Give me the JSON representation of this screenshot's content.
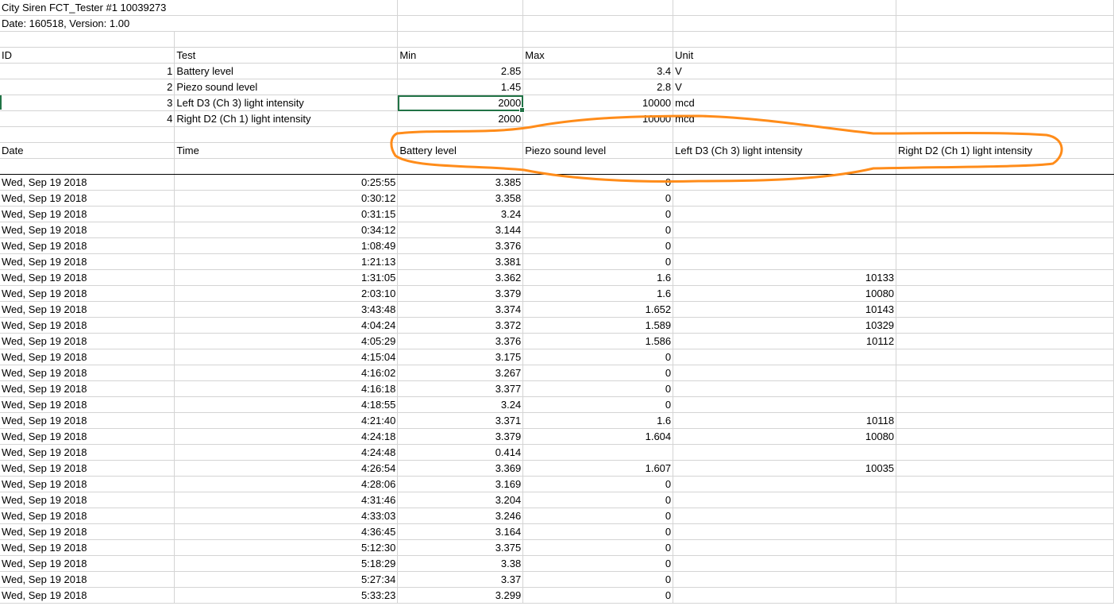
{
  "header": {
    "title": "City Siren FCT_Tester #1 10039273",
    "subtitle": "Date: 160518, Version: 1.00"
  },
  "limits": {
    "columns": [
      "ID",
      "Test",
      "Min",
      "Max",
      "Unit"
    ],
    "rows": [
      {
        "id": "1",
        "test": "Battery level",
        "min": "2.85",
        "max": "3.4",
        "unit": "V"
      },
      {
        "id": "2",
        "test": "Piezo sound level",
        "min": "1.45",
        "max": "2.8",
        "unit": "V"
      },
      {
        "id": "3",
        "test": "Left D3  (Ch 3) light intensity",
        "min": "2000",
        "max": "10000",
        "unit": "mcd"
      },
      {
        "id": "4",
        "test": "Right D2  (Ch 1) light intensity",
        "min": "2000",
        "max": "10000",
        "unit": "mcd"
      }
    ]
  },
  "log": {
    "columns": [
      "Date",
      "Time",
      "Battery level",
      "Piezo sound level",
      "Left D3  (Ch 3) light intensity",
      "Right D2  (Ch 1) light intensity"
    ],
    "rows": [
      {
        "date": "Wed, Sep 19  2018",
        "time": "0:25:55",
        "battery": "3.385",
        "piezo": "0",
        "left": "",
        "right": ""
      },
      {
        "date": "Wed, Sep 19  2018",
        "time": "0:30:12",
        "battery": "3.358",
        "piezo": "0",
        "left": "",
        "right": ""
      },
      {
        "date": "Wed, Sep 19  2018",
        "time": "0:31:15",
        "battery": "3.24",
        "piezo": "0",
        "left": "",
        "right": ""
      },
      {
        "date": "Wed, Sep 19  2018",
        "time": "0:34:12",
        "battery": "3.144",
        "piezo": "0",
        "left": "",
        "right": ""
      },
      {
        "date": "Wed, Sep 19  2018",
        "time": "1:08:49",
        "battery": "3.376",
        "piezo": "0",
        "left": "",
        "right": ""
      },
      {
        "date": "Wed, Sep 19  2018",
        "time": "1:21:13",
        "battery": "3.381",
        "piezo": "0",
        "left": "",
        "right": ""
      },
      {
        "date": "Wed, Sep 19  2018",
        "time": "1:31:05",
        "battery": "3.362",
        "piezo": "1.6",
        "left": "10133",
        "right": ""
      },
      {
        "date": "Wed, Sep 19  2018",
        "time": "2:03:10",
        "battery": "3.379",
        "piezo": "1.6",
        "left": "10080",
        "right": ""
      },
      {
        "date": "Wed, Sep 19  2018",
        "time": "3:43:48",
        "battery": "3.374",
        "piezo": "1.652",
        "left": "10143",
        "right": ""
      },
      {
        "date": "Wed, Sep 19  2018",
        "time": "4:04:24",
        "battery": "3.372",
        "piezo": "1.589",
        "left": "10329",
        "right": ""
      },
      {
        "date": "Wed, Sep 19  2018",
        "time": "4:05:29",
        "battery": "3.376",
        "piezo": "1.586",
        "left": "10112",
        "right": ""
      },
      {
        "date": "Wed, Sep 19  2018",
        "time": "4:15:04",
        "battery": "3.175",
        "piezo": "0",
        "left": "",
        "right": ""
      },
      {
        "date": "Wed, Sep 19  2018",
        "time": "4:16:02",
        "battery": "3.267",
        "piezo": "0",
        "left": "",
        "right": ""
      },
      {
        "date": "Wed, Sep 19  2018",
        "time": "4:16:18",
        "battery": "3.377",
        "piezo": "0",
        "left": "",
        "right": ""
      },
      {
        "date": "Wed, Sep 19  2018",
        "time": "4:18:55",
        "battery": "3.24",
        "piezo": "0",
        "left": "",
        "right": ""
      },
      {
        "date": "Wed, Sep 19  2018",
        "time": "4:21:40",
        "battery": "3.371",
        "piezo": "1.6",
        "left": "10118",
        "right": ""
      },
      {
        "date": "Wed, Sep 19  2018",
        "time": "4:24:18",
        "battery": "3.379",
        "piezo": "1.604",
        "left": "10080",
        "right": ""
      },
      {
        "date": "Wed, Sep 19  2018",
        "time": "4:24:48",
        "battery": "0.414",
        "piezo": "",
        "left": "",
        "right": ""
      },
      {
        "date": "Wed, Sep 19  2018",
        "time": "4:26:54",
        "battery": "3.369",
        "piezo": "1.607",
        "left": "10035",
        "right": ""
      },
      {
        "date": "Wed, Sep 19  2018",
        "time": "4:28:06",
        "battery": "3.169",
        "piezo": "0",
        "left": "",
        "right": ""
      },
      {
        "date": "Wed, Sep 19  2018",
        "time": "4:31:46",
        "battery": "3.204",
        "piezo": "0",
        "left": "",
        "right": ""
      },
      {
        "date": "Wed, Sep 19  2018",
        "time": "4:33:03",
        "battery": "3.246",
        "piezo": "0",
        "left": "",
        "right": ""
      },
      {
        "date": "Wed, Sep 19  2018",
        "time": "4:36:45",
        "battery": "3.164",
        "piezo": "0",
        "left": "",
        "right": ""
      },
      {
        "date": "Wed, Sep 19  2018",
        "time": "5:12:30",
        "battery": "3.375",
        "piezo": "0",
        "left": "",
        "right": ""
      },
      {
        "date": "Wed, Sep 19  2018",
        "time": "5:18:29",
        "battery": "3.38",
        "piezo": "0",
        "left": "",
        "right": ""
      },
      {
        "date": "Wed, Sep 19  2018",
        "time": "5:27:34",
        "battery": "3.37",
        "piezo": "0",
        "left": "",
        "right": ""
      },
      {
        "date": "Wed, Sep 19  2018",
        "time": "5:33:23",
        "battery": "3.299",
        "piezo": "0",
        "left": "",
        "right": ""
      }
    ]
  },
  "colors": {
    "annotation": "#ff8c1a",
    "selection": "#217346",
    "gridline": "#d4d4d4"
  }
}
